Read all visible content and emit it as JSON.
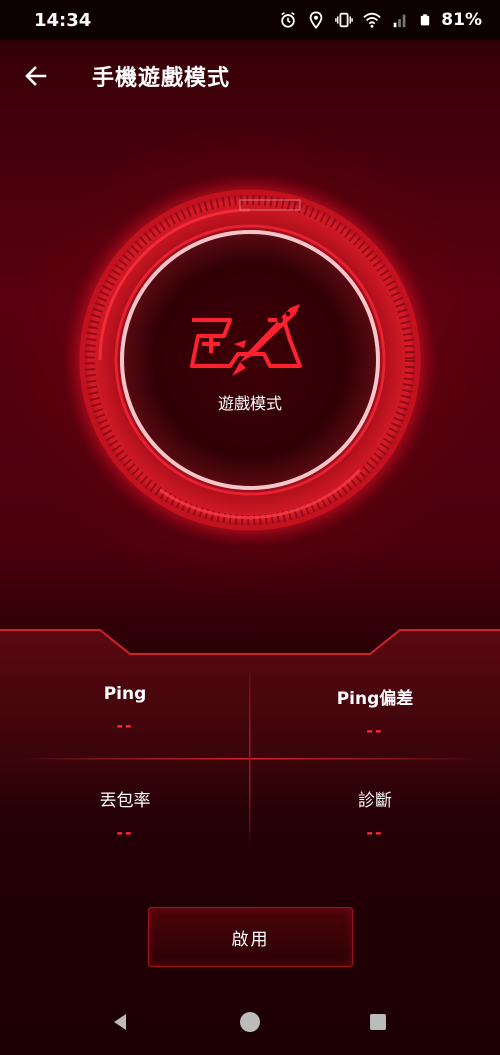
{
  "status_bar": {
    "time": "14:34",
    "battery_percent": "81%",
    "icons": [
      "alarm-icon",
      "location-icon",
      "vibrate-icon",
      "wifi-icon",
      "signal-icon",
      "battery-icon"
    ]
  },
  "app_bar": {
    "title": "手機遊戲模式",
    "back_icon": "back-arrow-icon"
  },
  "dial": {
    "label": "遊戲模式",
    "icon": "game-rocket-icon"
  },
  "stats": {
    "ping_label": "Ping",
    "ping_value": "--",
    "jitter_label": "Ping偏差",
    "jitter_value": "--",
    "loss_label": "丟包率",
    "loss_value": "--",
    "diagnosis_label": "診斷",
    "diagnosis_value": "--"
  },
  "enable_button": {
    "label": "啟用"
  },
  "nav_bar": {
    "icons": [
      "back-triangle-icon",
      "home-circle-icon",
      "recents-square-icon"
    ]
  },
  "colors": {
    "accent": "#ff2a3a",
    "background": "#3a0008",
    "ring": "#e01a2c"
  }
}
